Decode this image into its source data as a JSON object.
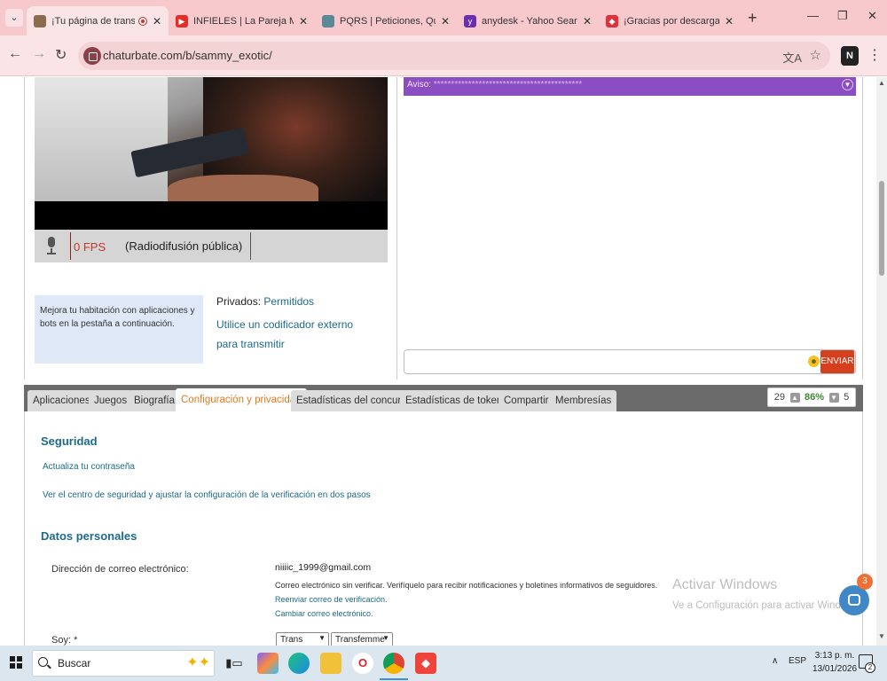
{
  "browser": {
    "tabs": [
      {
        "title": "¡Tu página de transmisió",
        "favicon_color": "#8a6b4d",
        "recording": true,
        "close": "✕"
      },
      {
        "title": "INFIELES | La Pareja Más BIZ",
        "favicon_color": "#e52d27",
        "close": "✕"
      },
      {
        "title": "PQRS | Peticiones, Quejas y",
        "favicon_color": "#5a8a9a",
        "close": "✕"
      },
      {
        "title": "anydesk - Yahoo Search Tus",
        "favicon_color": "#6b2fb3",
        "close": "✕"
      },
      {
        "title": "¡Gracias por descargar AnyD",
        "favicon_color": "#e0323a",
        "close": "✕"
      }
    ],
    "new_tab": "+",
    "window_controls": {
      "minimize": "—",
      "restore": "❐",
      "close": "✕"
    },
    "nav": {
      "back": "←",
      "forward": "→",
      "reload": "↻"
    },
    "url": "chaturbate.com/b/sammy_exotic/",
    "ext_label": "N",
    "menu": "⋮"
  },
  "broadcast": {
    "fps": "0 FPS",
    "mode": "(Radiodifusión pública)"
  },
  "info_box": "Mejora tu habitación con aplicaciones y bots en la pestaña a continuación.",
  "privados": {
    "label": "Privados:",
    "value": "Permitidos",
    "encoder_link": "Utilice un codificador externo para transmitir"
  },
  "chat": {
    "aviso_label": "Aviso:",
    "aviso_text": "*******************************************",
    "send_label": "ENVIAR"
  },
  "tabs": [
    {
      "label": "Aplicaciones",
      "active": false
    },
    {
      "label": "Juegos",
      "active": false
    },
    {
      "label": "Biografía",
      "active": false
    },
    {
      "label": "Configuración y privacidad",
      "active": true
    },
    {
      "label": "Estadísticas del concurso",
      "active": false
    },
    {
      "label": "Estadísticas de tokens",
      "active": false
    },
    {
      "label": "Compartir",
      "active": false
    },
    {
      "label": "Membresías",
      "active": false
    }
  ],
  "votes": {
    "up": "29",
    "percent": "86%",
    "down": "5"
  },
  "security": {
    "title": "Seguridad",
    "update_password": "Actualiza tu contraseña",
    "security_center": "Ver el centro de seguridad y ajustar la configuración de la verificación en dos pasos"
  },
  "personal": {
    "title": "Datos personales",
    "email_label": "Dirección de correo electrónico:",
    "email": "niiiic_1999@gmail.com",
    "email_note": "Correo electrónico sin verificar. Verifíquelo para recibir notificaciones y boletines informativos de seguidores.",
    "resend": "Reenviar correo de verificación.",
    "change": "Cambiar correo electrónico.",
    "soy_label": "Soy: *",
    "soy_select_1": "Trans",
    "soy_select_2": "Transfemme"
  },
  "windows_watermark": {
    "title": "Activar Windows",
    "subtitle": "Ve a Configuración para activar Windo"
  },
  "chat_widget_badge": "3",
  "taskbar": {
    "search": "Buscar",
    "lang": "ESP",
    "time": "3:13 p. m.",
    "date": "13/01/2026",
    "notif_count": "2"
  }
}
